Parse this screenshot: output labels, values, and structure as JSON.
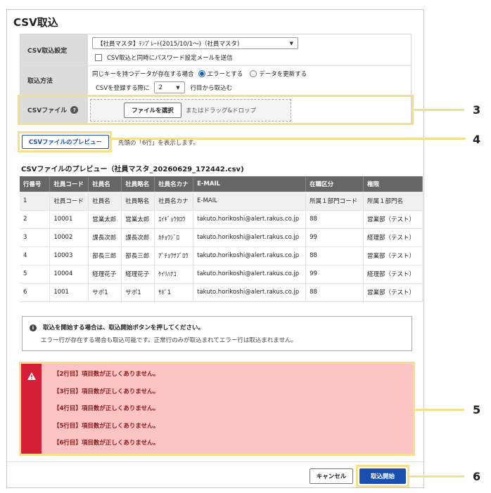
{
  "title": "CSV取込",
  "form": {
    "settings_label": "CSV取込設定",
    "template_value": "【社員マスタ】ﾃﾝﾌﾟﾚｰﾄ(2015/10/1～)（社員マスタ)",
    "send_mail_label": "CSV取込と同時にパスワード設定メールを送信",
    "method_label": "取込方法",
    "duplicate_label": "同じキーを持つデータが存在する場合",
    "radio_error": "エラーとする",
    "radio_update": "データを更新する",
    "start_row_prefix": "CSVを登録する際に",
    "start_row_value": "2",
    "start_row_suffix": "行目から取込む",
    "file_label": "CSVファイル",
    "choose_file": "ファイルを選択",
    "drag_drop": "またはドラッグ&ドロップ"
  },
  "preview": {
    "button": "CSVファイルのプレビュー",
    "note": "先頭の「6行」を表示します。",
    "title": "CSVファイルのプレビュー（社員マスタ_20260629_172442.csv)",
    "columns": [
      "行番号",
      "社員コード",
      "社員名",
      "社員略名",
      "社員名カナ",
      "E-MAIL",
      "在職区分",
      "権限"
    ],
    "rows": [
      [
        "1",
        "社員コード",
        "社員名",
        "社員略名",
        "社員名カナ",
        "E-MAIL",
        "所属１部門コード",
        "所属１部門名"
      ],
      [
        "2",
        "10001",
        "営業太郎",
        "営業太郎",
        "ｴｲｷﾞｮｳﾀﾛｳ",
        "takuto.horikoshi@alert.rakus.co.jp",
        "88",
        "営業部（テスト）"
      ],
      [
        "3",
        "10002",
        "課長次郎",
        "課長次郎",
        "ｶﾁｮｳｼﾞﾛ",
        "takuto.horikoshi@alert.rakus.co.jp",
        "99",
        "経理部（テスト）"
      ],
      [
        "4",
        "10003",
        "部長三郎",
        "部長三郎",
        "ｱﾞﾁｮｳｻﾌﾞﾛｳ",
        "takuto.horikoshi@alert.rakus.co.jp",
        "88",
        "営業部（テスト）"
      ],
      [
        "5",
        "10004",
        "経理花子",
        "経理花子",
        "ｹｲﾘﾊﾅｺ",
        "takuto.horikoshi@alert.rakus.co.jp",
        "99",
        "経理部（テスト）"
      ],
      [
        "6",
        "1001",
        "サポ1",
        "サポ1",
        "ｻﾎﾟ1",
        "takuto.horikoshi@alert.rakus.co.jp",
        "88",
        "営業部（テスト）"
      ]
    ]
  },
  "info": {
    "line1": "取込を開始する場合は、取込開始ボタンを押してください。",
    "line2": "エラー行が存在する場合も取込可能です。正常行のみが取込まれてエラー行は取込まれません。"
  },
  "errors": [
    "【2行目】項目数が正しくありません。",
    "【3行目】項目数が正しくありません。",
    "【4行目】項目数が正しくありません。",
    "【5行目】項目数が正しくありません。",
    "【6行目】項目数が正しくありません。"
  ],
  "footer": {
    "cancel": "キャンセル",
    "start": "取込開始"
  },
  "callouts": [
    "3",
    "4",
    "5",
    "6"
  ],
  "colors": {
    "highlight": "#f6df8a",
    "primary": "#1a4fb0",
    "error_bar": "#d41f37",
    "error_bg": "#fcc5c3",
    "header_bg": "#666666"
  }
}
